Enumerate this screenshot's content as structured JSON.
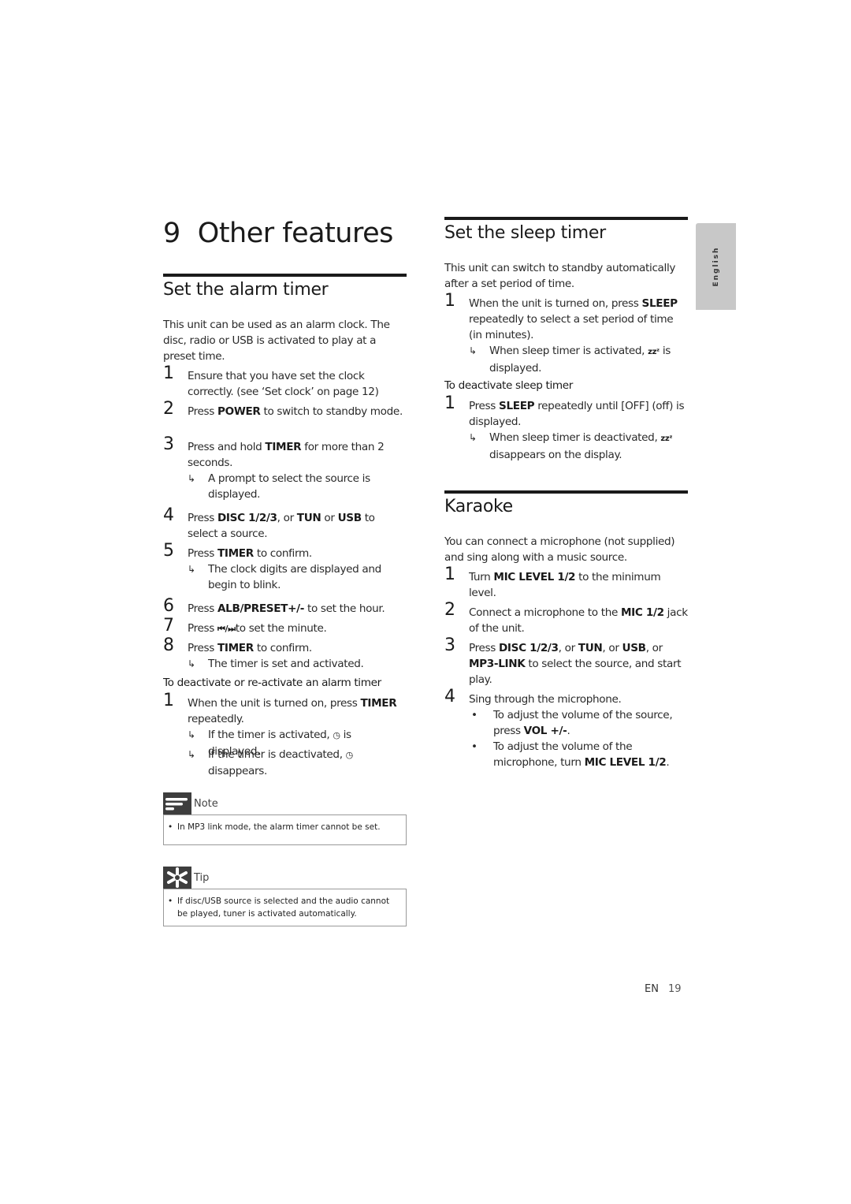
{
  "chapter": {
    "number": "9",
    "title": "Other features"
  },
  "language_tab": "English",
  "alarm": {
    "heading": "Set the alarm timer",
    "intro": "This unit can be used as an alarm clock. The disc, radio or USB is activated to play at a preset time.",
    "steps": [
      {
        "n": "1",
        "pre": "Ensure that you have set the clock correctly. (see ‘Set clock’ on page 12)"
      },
      {
        "n": "2",
        "pre": "Press ",
        "bold": "POWER",
        "post": " to switch to standby mode."
      },
      {
        "n": "3",
        "pre": "Press and hold ",
        "bold": "TIMER",
        "post": " for more than 2 seconds.",
        "result": "A prompt to select the source is displayed."
      },
      {
        "n": "4",
        "pre": "Press ",
        "bold": "DISC 1/2/3",
        "mid": ", or ",
        "bold2": "TUN",
        "mid2": " or ",
        "bold3": "USB",
        "post": " to select a source."
      },
      {
        "n": "5",
        "pre": "Press ",
        "bold": "TIMER",
        "post": " to confirm.",
        "result": "The clock digits are displayed and begin to blink."
      },
      {
        "n": "6",
        "pre": "Press ",
        "bold": "ALB/PRESET+/-",
        "post": " to set the hour."
      },
      {
        "n": "7",
        "pre": "Press ",
        "bold": "⏮/⏭",
        "post": "to set the minute."
      },
      {
        "n": "8",
        "pre": "Press ",
        "bold": "TIMER",
        "post": " to confirm.",
        "result": "The timer is set and activated."
      }
    ],
    "deactivate": {
      "heading": "To deactivate or re-activate an alarm timer",
      "step": {
        "n": "1",
        "pre": "When the unit is turned on, press ",
        "bold": "TIMER",
        "post": " repeatedly."
      },
      "results": [
        {
          "pre": "If the timer is activated, ",
          "icon": "◷",
          "post": " is displayed."
        },
        {
          "pre": "If the timer is deactivated, ",
          "icon": "◷",
          "post": " disappears."
        }
      ]
    },
    "note": {
      "label": "Note",
      "items": [
        "In MP3 link mode, the alarm timer cannot be set."
      ]
    },
    "tip": {
      "label": "Tip",
      "items": [
        "If disc/USB source is selected and the audio cannot be played, tuner is activated automatically."
      ]
    }
  },
  "sleep": {
    "heading": "Set the sleep timer",
    "intro": "This unit can switch to standby automatically after a set period of time.",
    "step": {
      "n": "1",
      "pre": "When the unit is turned on, press ",
      "bold": "SLEEP",
      "post": " repeatedly to select a set period of time (in minutes).",
      "result_pre": "When sleep timer is activated, ",
      "result_icon": "zzᶻ",
      "result_post": " is displayed."
    },
    "deactivate": {
      "heading": "To deactivate sleep timer",
      "step": {
        "n": "1",
        "pre": "Press ",
        "bold": "SLEEP",
        "post": " repeatedly until [OFF] (off) is displayed.",
        "result_pre": "When sleep timer is deactivated, ",
        "result_icon": "zzᶻ",
        "result_post": " disappears on the display."
      }
    }
  },
  "karaoke": {
    "heading": "Karaoke",
    "intro": "You can connect a microphone (not supplied) and sing along with a music source.",
    "steps": [
      {
        "n": "1",
        "pre": "Turn ",
        "bold": "MIC LEVEL 1/2",
        "post": " to the minimum level."
      },
      {
        "n": "2",
        "pre": "Connect a microphone to the ",
        "bold": "MIC 1/2",
        "post": " jack of the unit."
      },
      {
        "n": "3",
        "pre": "Press ",
        "bold": "DISC 1/2/3",
        "mid": ", or ",
        "bold2": "TUN",
        "mid2": ", or ",
        "bold3": "USB",
        "mid3": ", or ",
        "bold4": "MP3-LINK",
        "post": " to select the source, and start play."
      },
      {
        "n": "4",
        "pre": "Sing through the microphone."
      }
    ],
    "bullets": [
      {
        "pre": "To adjust the volume of the source, press ",
        "bold": "VOL +/-",
        "post": "."
      },
      {
        "pre": "To adjust the volume of the microphone, turn ",
        "bold": "MIC LEVEL 1/2",
        "post": "."
      }
    ]
  },
  "footer": {
    "lang": "EN",
    "page": "19"
  },
  "glyphs": {
    "result_arrow": "↳",
    "bullet": "•"
  }
}
